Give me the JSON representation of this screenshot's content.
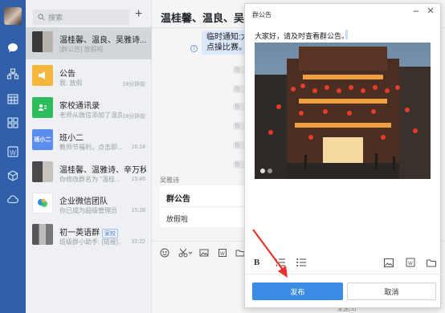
{
  "sidebar": {
    "icons": [
      "chat-icon",
      "contacts-icon",
      "calendar-icon",
      "workbench-icon",
      "doc-icon",
      "cube-icon",
      "cloud-icon"
    ]
  },
  "chatlist": {
    "search_placeholder": "搜索",
    "items": [
      {
        "title": "温桂馨、温良、吴雅诗...",
        "sub": "[群公告] 放假啦",
        "time": "",
        "badge": ""
      },
      {
        "title": "公告",
        "sub": "我: 放假",
        "time": "19分钟前",
        "badge": ""
      },
      {
        "title": "家校通讯录",
        "sub": "老师从微信添加了温良...",
        "time": "19分钟前",
        "badge": ""
      },
      {
        "title": "班小二",
        "sub": "教师节福利，点击即...",
        "time": "16:14",
        "badge": ""
      },
      {
        "title": "温桂馨、温雅诗、辛万秋",
        "sub": "你修改群名为 \"温桂...",
        "time": "15:46",
        "badge": ""
      },
      {
        "title": "企业微信团队",
        "sub": "你已成为超级管理员",
        "time": "15:28",
        "badge": ""
      },
      {
        "title": "初一英语群",
        "sub": "班级群小助手: [链接]...",
        "time": "10:22",
        "badge": "家校"
      }
    ]
  },
  "chat": {
    "title": "温桂馨、温良、吴雅诗",
    "bubble": "临时通知:大家下午三点操比赛。",
    "marker": "2",
    "faint": [
      "你",
      "你",
      "你",
      "你",
      "你",
      "你",
      "你",
      "你"
    ],
    "sender": "吴雅诗",
    "card": {
      "title": "群公告",
      "body": "放假啦"
    },
    "send_hint": "发送(S)"
  },
  "dialog": {
    "title": "群公告",
    "text": "大家好，请及时查看群公告。",
    "format_bold": "B",
    "publish_label": "发布",
    "cancel_label": "取消"
  },
  "colors": {
    "nav": "#2e5fa8",
    "accent": "#3c8ce6",
    "arrow": "#e8322b"
  }
}
